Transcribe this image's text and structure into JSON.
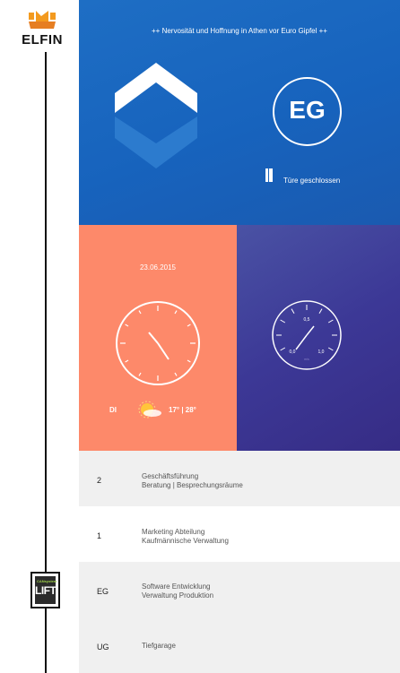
{
  "brand": {
    "logo_text": "ELFIN",
    "lift_top": "CANsystem",
    "lift_main": "LIFT"
  },
  "ticker": "++ Nervosität und Hoffnung in Athen vor Euro Gipfel ++",
  "current_floor": "EG",
  "door_status": "Türe geschlossen",
  "date": "23.06.2015",
  "weather": {
    "weekday": "DI",
    "temps": "17° | 28°",
    "icon": "sun-cloud-icon"
  },
  "gauge": {
    "labels": [
      "0,5",
      "0,0",
      "1,0"
    ],
    "unit": "m/s"
  },
  "floors": [
    {
      "num": "2",
      "line1": "Geschäftsführung",
      "line2": "Beratung | Besprechungsräume"
    },
    {
      "num": "1",
      "line1": "Marketing Abteilung",
      "line2": "Kaufmännische Verwaltung"
    },
    {
      "num": "EG",
      "line1": "Software Entwicklung",
      "line2": "Verwaltung Produktion"
    },
    {
      "num": "UG",
      "line1": "Tiefgarage",
      "line2": ""
    }
  ],
  "colors": {
    "blue": "#1763bd",
    "salmon": "#fd896a",
    "purple": "#3c3896"
  }
}
